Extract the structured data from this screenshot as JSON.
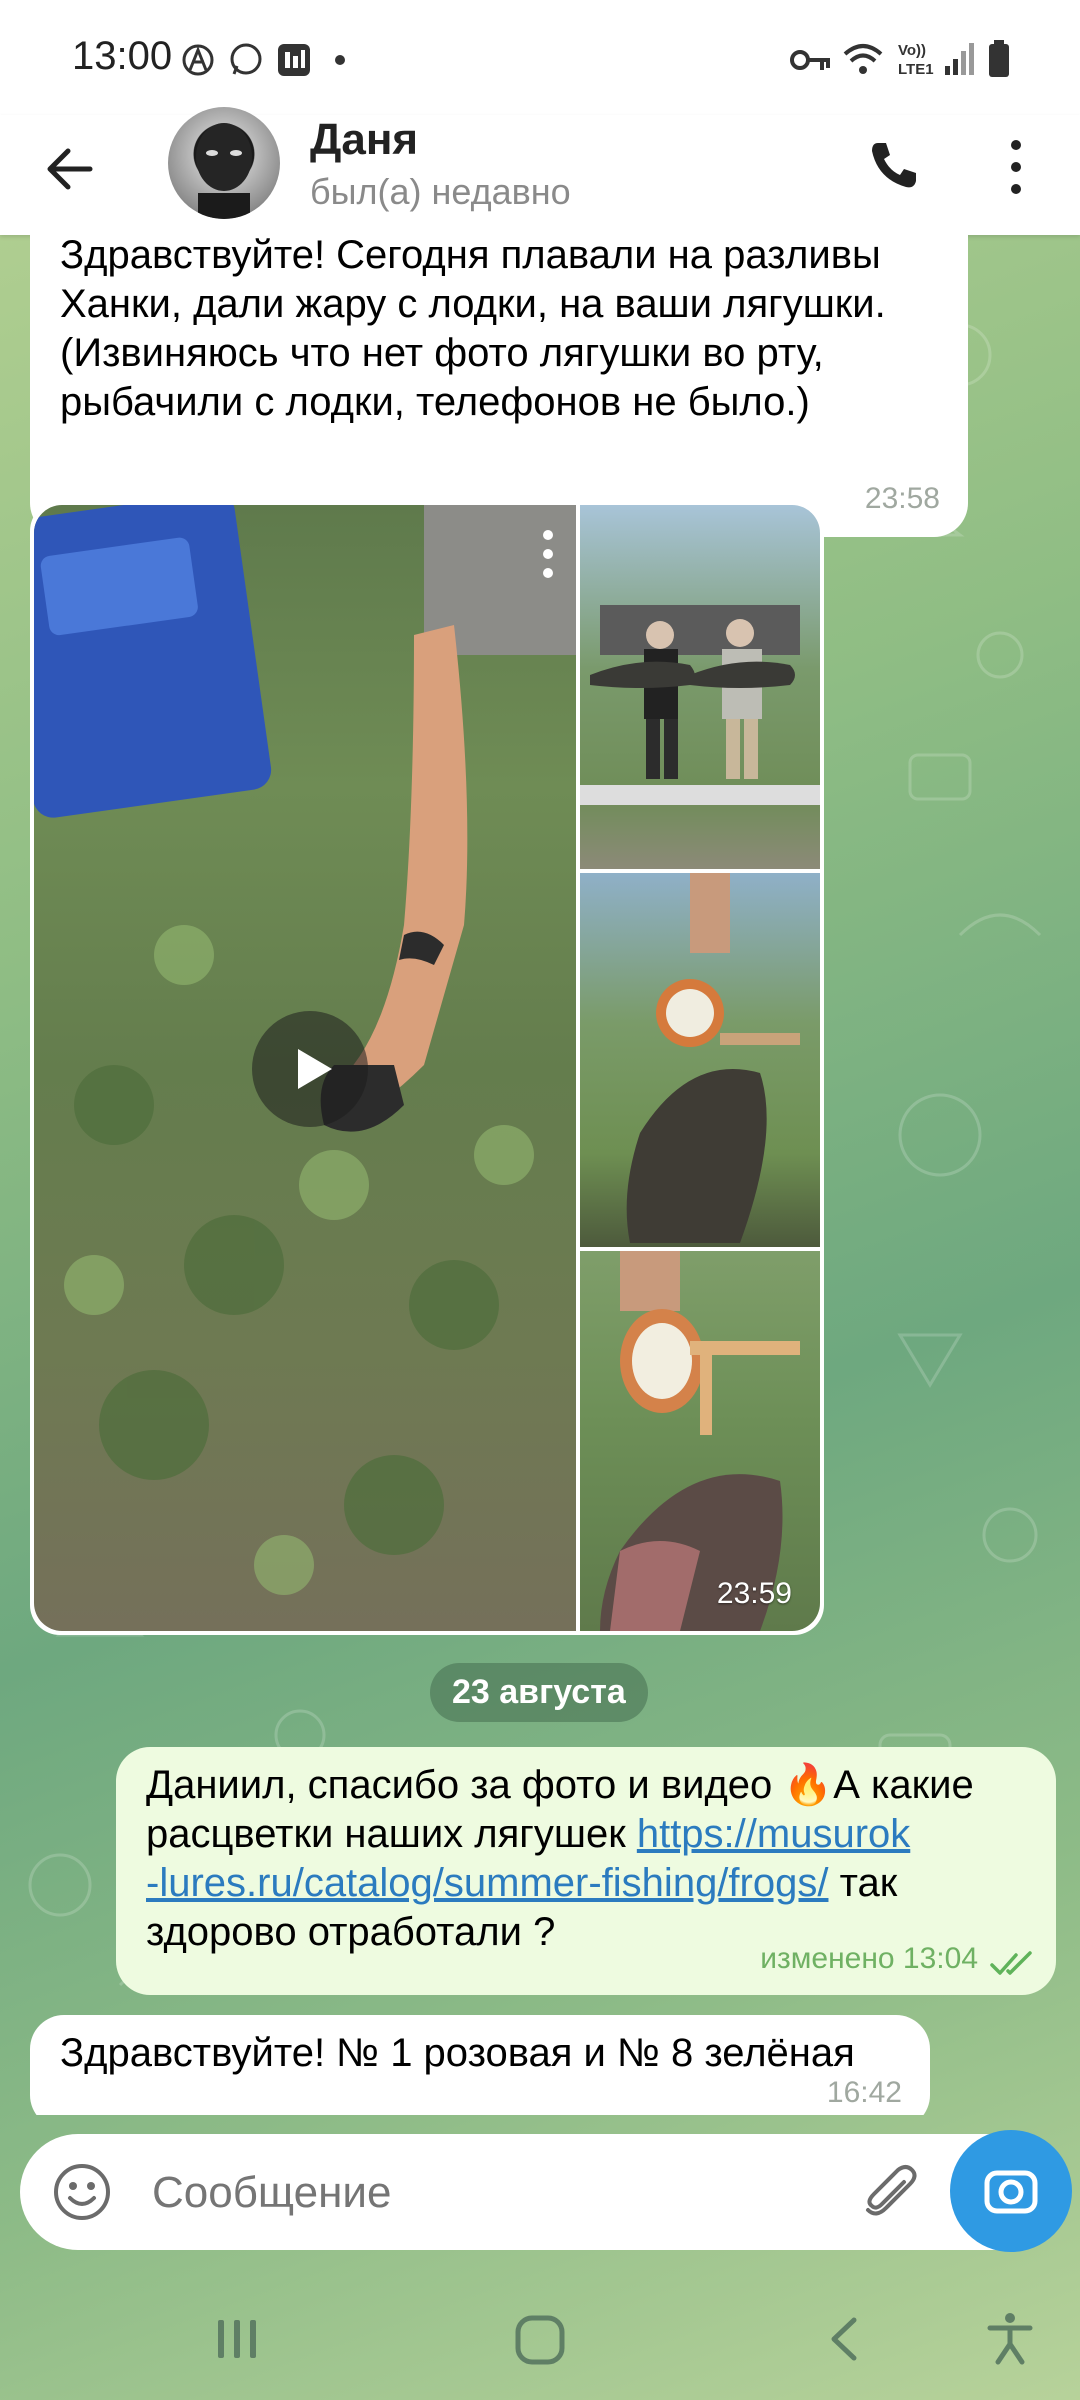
{
  "status_bar": {
    "time": "13:00"
  },
  "header": {
    "contact_name": "Даня",
    "last_seen": "был(а) недавно"
  },
  "messages": {
    "m1": {
      "text": "Здравствуйте! Сегодня плавали на разливы Ханки, дали жару с лодки, на ваши лягушки. (Извиняюсь что нет фото лягушки во рту, рыбачили с лодки, телефонов не было.)",
      "time": "23:58"
    },
    "m2": {
      "time": "23:59"
    },
    "date_separator": "23 августа",
    "m3": {
      "text_before": "Даниил, спасибо за фото и видео 🔥А какие расцветки наших лягушек ",
      "link": "https://musurok-lures.ru/catalog/summer-fishing/frogs/",
      "link_line1": "https://musurok",
      "link_line2": "-lures.ru/catalog/summer-fishing/frogs/",
      "text_after": " так здорово отработали ?",
      "time": "изменено 13:04"
    },
    "m4": {
      "text": "Здравствуйте! № 1 розовая и №  8 зелёная",
      "time": "16:42"
    }
  },
  "composer": {
    "placeholder": "Сообщение"
  },
  "colors": {
    "accent": "#2f9ae3",
    "link": "#2b7bbf",
    "read_check": "#5fb35a",
    "outgoing_bubble": "#eefbe0"
  }
}
